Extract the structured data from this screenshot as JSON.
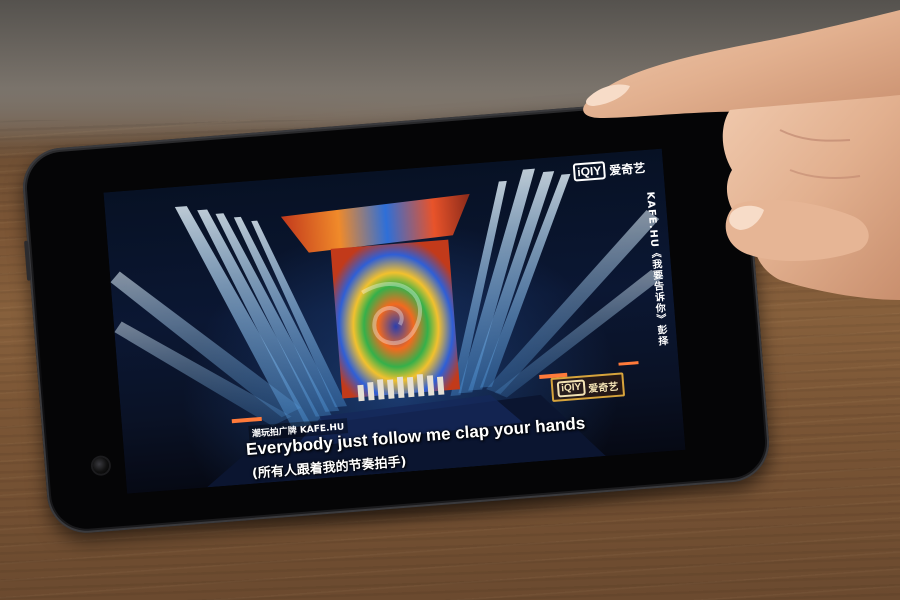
{
  "screen": {
    "logo_top": {
      "box_text": "iQIY",
      "text": "爱奇艺"
    },
    "side_caption": "KAFE.HU《我要告诉你》彭择",
    "logo_bottom": {
      "box_text": "iQIY",
      "text": "爱奇艺"
    },
    "credit": "潮玩拍广牌 KAFE.HU",
    "subtitle_en": "Everybody just follow me clap your hands",
    "subtitle_cn": "(所有人跟着我的节奏拍手)"
  },
  "colors": {
    "stage_beam": "#bfe6ff",
    "swirl_orange": "#f26a1f",
    "swirl_blue": "#2f5fd6",
    "logo_gold": "#d7a43c",
    "table_wood": "#7b5535"
  }
}
